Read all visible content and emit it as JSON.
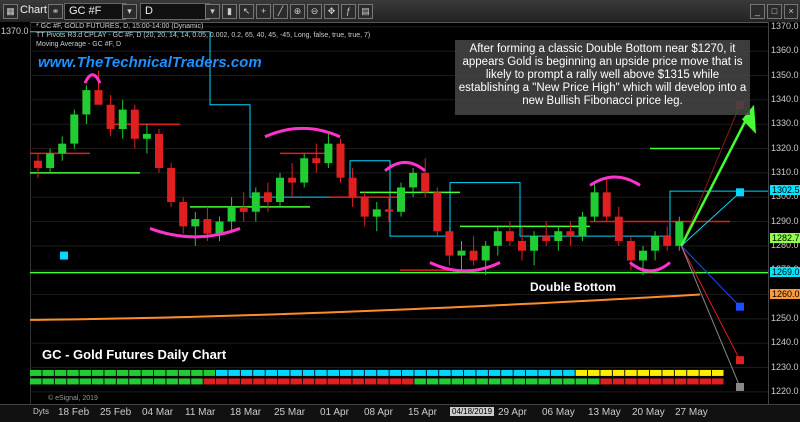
{
  "toolbar": {
    "window_label": "Chart",
    "symbol": "GC #F",
    "interval": "D"
  },
  "legend": {
    "line1": "* GC #F, GOLD FUTURES, D, 15:00-14:00 (Dynamic)",
    "line2": "TT Pivots R3.d CPLAY - GC #F, D (20, 20, 14, 14, 0.05, 0.002, 0.2, 65, 40, 45, -45, Long, false, true, true, 7)",
    "line3": "Moving Average - GC #F, D"
  },
  "site_link": "www.TheTechnicalTraders.com",
  "callout": "After forming a classic Double Bottom near $1270, it appears Gold is beginning an upside price move that is likely to prompt a rally well above $1315 while establishing a \"New Price High\" which will develop into a new Bullish Fibonacci price leg.",
  "double_bottom_label": "Double Bottom",
  "chart_title": "GC - Gold Futures Daily Chart",
  "copyright": "© eSignal, 2019",
  "y_axis": {
    "ticks": [
      "1370.0",
      "1360.0",
      "1350.0",
      "1340.0",
      "1330.0",
      "1320.0",
      "1310.0",
      "1300.0",
      "1290.0",
      "1280.0",
      "1270.0",
      "1260.0",
      "1250.0",
      "1240.0",
      "1230.0",
      "1220.0"
    ],
    "price_tags": [
      {
        "label": "1302.5",
        "color": "#00e5ff"
      },
      {
        "label": "1282.7",
        "color": "#8fff4c"
      },
      {
        "label": "1269.0",
        "color": "#00e5ff"
      },
      {
        "label": "1260.0",
        "color": "#ff9a3c"
      }
    ],
    "left_top": "1370.0"
  },
  "x_axis": {
    "prefix": "Dyts",
    "ticks": [
      "18 Feb",
      "25 Feb",
      "04 Mar",
      "11 Mar",
      "18 Mar",
      "25 Mar",
      "01 Apr",
      "08 Apr",
      "15 Apr",
      "04/18/2019",
      "29 Apr",
      "06 May",
      "13 May",
      "20 May",
      "27 May"
    ]
  },
  "colors": {
    "bull": "#22cc33",
    "bear": "#e02020",
    "cyan": "#00d8ff",
    "lime": "#44ff33",
    "magenta": "#ff33cc",
    "orange": "#ff8c2a",
    "red_line": "#e02020"
  },
  "chart_data": {
    "type": "candlestick",
    "ylim": [
      1215,
      1372
    ],
    "candles": [
      [
        1315,
        1318,
        1308,
        1312
      ],
      [
        1312,
        1320,
        1310,
        1318
      ],
      [
        1318,
        1325,
        1315,
        1322
      ],
      [
        1322,
        1336,
        1320,
        1334
      ],
      [
        1334,
        1346,
        1330,
        1344
      ],
      [
        1344,
        1352,
        1340,
        1338
      ],
      [
        1338,
        1342,
        1325,
        1328
      ],
      [
        1328,
        1340,
        1324,
        1336
      ],
      [
        1336,
        1338,
        1320,
        1324
      ],
      [
        1324,
        1330,
        1318,
        1326
      ],
      [
        1326,
        1328,
        1310,
        1312
      ],
      [
        1312,
        1314,
        1296,
        1298
      ],
      [
        1298,
        1300,
        1285,
        1288
      ],
      [
        1288,
        1294,
        1280,
        1291
      ],
      [
        1291,
        1296,
        1282,
        1285
      ],
      [
        1285,
        1292,
        1282,
        1290
      ],
      [
        1290,
        1300,
        1286,
        1296
      ],
      [
        1296,
        1302,
        1290,
        1294
      ],
      [
        1294,
        1304,
        1290,
        1302
      ],
      [
        1302,
        1306,
        1294,
        1298
      ],
      [
        1298,
        1310,
        1296,
        1308
      ],
      [
        1308,
        1314,
        1300,
        1306
      ],
      [
        1306,
        1318,
        1304,
        1316
      ],
      [
        1316,
        1322,
        1310,
        1314
      ],
      [
        1314,
        1326,
        1312,
        1322
      ],
      [
        1322,
        1324,
        1306,
        1308
      ],
      [
        1308,
        1312,
        1296,
        1300
      ],
      [
        1300,
        1302,
        1288,
        1292
      ],
      [
        1292,
        1298,
        1286,
        1295
      ],
      [
        1295,
        1300,
        1290,
        1294
      ],
      [
        1294,
        1306,
        1292,
        1304
      ],
      [
        1304,
        1312,
        1300,
        1310
      ],
      [
        1310,
        1316,
        1300,
        1302
      ],
      [
        1302,
        1304,
        1284,
        1286
      ],
      [
        1286,
        1288,
        1272,
        1276
      ],
      [
        1276,
        1282,
        1270,
        1278
      ],
      [
        1278,
        1284,
        1272,
        1274
      ],
      [
        1274,
        1282,
        1268,
        1280
      ],
      [
        1280,
        1288,
        1276,
        1286
      ],
      [
        1286,
        1290,
        1280,
        1282
      ],
      [
        1282,
        1288,
        1274,
        1278
      ],
      [
        1278,
        1286,
        1272,
        1284
      ],
      [
        1284,
        1290,
        1280,
        1282
      ],
      [
        1282,
        1288,
        1278,
        1286
      ],
      [
        1286,
        1290,
        1280,
        1284
      ],
      [
        1284,
        1294,
        1282,
        1292
      ],
      [
        1292,
        1306,
        1290,
        1302
      ],
      [
        1302,
        1308,
        1290,
        1292
      ],
      [
        1292,
        1296,
        1280,
        1282
      ],
      [
        1282,
        1284,
        1270,
        1274
      ],
      [
        1274,
        1280,
        1268,
        1278
      ],
      [
        1278,
        1286,
        1274,
        1284
      ],
      [
        1284,
        1288,
        1278,
        1280
      ],
      [
        1280,
        1292,
        1278,
        1290
      ]
    ],
    "levels": [
      {
        "name": "double-bottom-support",
        "value": 1269,
        "color": "#44ff33"
      },
      {
        "name": "moving-average-end",
        "value": 1260,
        "color": "#ff8c2a"
      }
    ]
  }
}
